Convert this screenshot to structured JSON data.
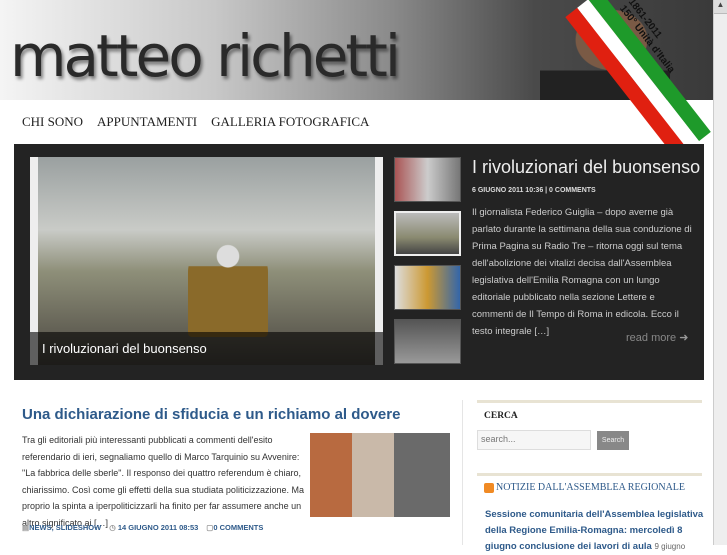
{
  "header": {
    "logo": "matteo richetti",
    "badge_years": "1861-2011",
    "badge_text": "150° Unità d'Italia"
  },
  "nav": [
    "CHI SONO",
    "APPUNTAMENTI",
    "GALLERIA FOTOGRAFICA"
  ],
  "slideshow": {
    "caption": "I rivoluzionari del buonsenso",
    "title": "I rivoluzionari del buonsenso",
    "meta": "6 GIUGNO 2011 10:36 | 0 COMMENTS",
    "text": "Il giornalista Federico Guiglia – dopo averne già parlato durante la settimana della sua conduzione di Prima Pagina su Radio Tre – ritorna oggi sul tema dell'abolizione dei vitalizi decisa dall'Assemblea legislativa dell'Emilia Romagna con un lungo editoriale pubblicato nella sezione Lettere e commenti de Il Tempo di Roma in edicola. Ecco il testo integrale […]",
    "read_more": "read more"
  },
  "post": {
    "title": "Una dichiarazione di sfiducia e un richiamo al dovere",
    "text": "Tra gli editoriali più interessanti pubblicati a commenti dell'esito referendario di ieri, segnaliamo quello di Marco Tarquinio su Avvenire: \"La fabbrica delle sberle\". Il responso dei quattro referendum è chiaro, chiarissimo. Così come gli effetti della sua studiata politicizzazione. Ma proprio la spinta a iperpoliticizzarli ha finito per far assumere anche un altro significato ai […]",
    "categories": "NEWS, SLIDESHOW",
    "date": "14 GIUGNO 2011 08:53",
    "comments": "0 COMMENTS"
  },
  "sidebar": {
    "search_heading": "CERCA",
    "search_placeholder": "search...",
    "search_button": "Search",
    "news_heading": "NOTIZIE DALL'ASSEMBLEA REGIONALE",
    "news_link": "Sessione comunitaria dell'Assemblea legislativa della Regione Emilia-Romagna: mercoledì 8 giugno conclusione dei lavori di aula",
    "news_date": "9 giugno"
  }
}
